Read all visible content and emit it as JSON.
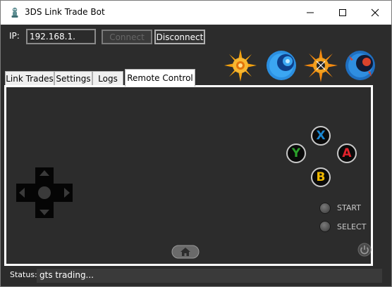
{
  "window": {
    "title": "3DS Link Trade Bot",
    "controls": [
      "minimize-icon",
      "maximize-icon",
      "close-icon"
    ]
  },
  "connection": {
    "ip_label": "IP:",
    "ip_value": "192.168.1.",
    "connect_label": "Connect",
    "connect_enabled": false,
    "disconnect_label": "Disconnect"
  },
  "logos": [
    "sun-logo-icon",
    "moon-logo-icon",
    "ultra-sun-logo-icon",
    "ultra-moon-logo-icon"
  ],
  "tabs": [
    {
      "label": "Link Trades",
      "active": false
    },
    {
      "label": "Settings",
      "active": false
    },
    {
      "label": "Logs",
      "active": false
    },
    {
      "label": "Remote Control",
      "active": true
    }
  ],
  "remote": {
    "buttons": {
      "x": "X",
      "y": "Y",
      "a": "A",
      "b": "B"
    },
    "start_label": "START",
    "select_label": "SELECT",
    "icons": [
      "dpad-icon",
      "home-icon",
      "power-icon"
    ]
  },
  "status": {
    "label": "Status:",
    "text": "gts trading..."
  },
  "colors": {
    "x_button": "#1a86d0",
    "y_button": "#2aa02a",
    "a_button": "#e0222a",
    "b_button": "#f0b800",
    "background": "#2c2c2c"
  }
}
